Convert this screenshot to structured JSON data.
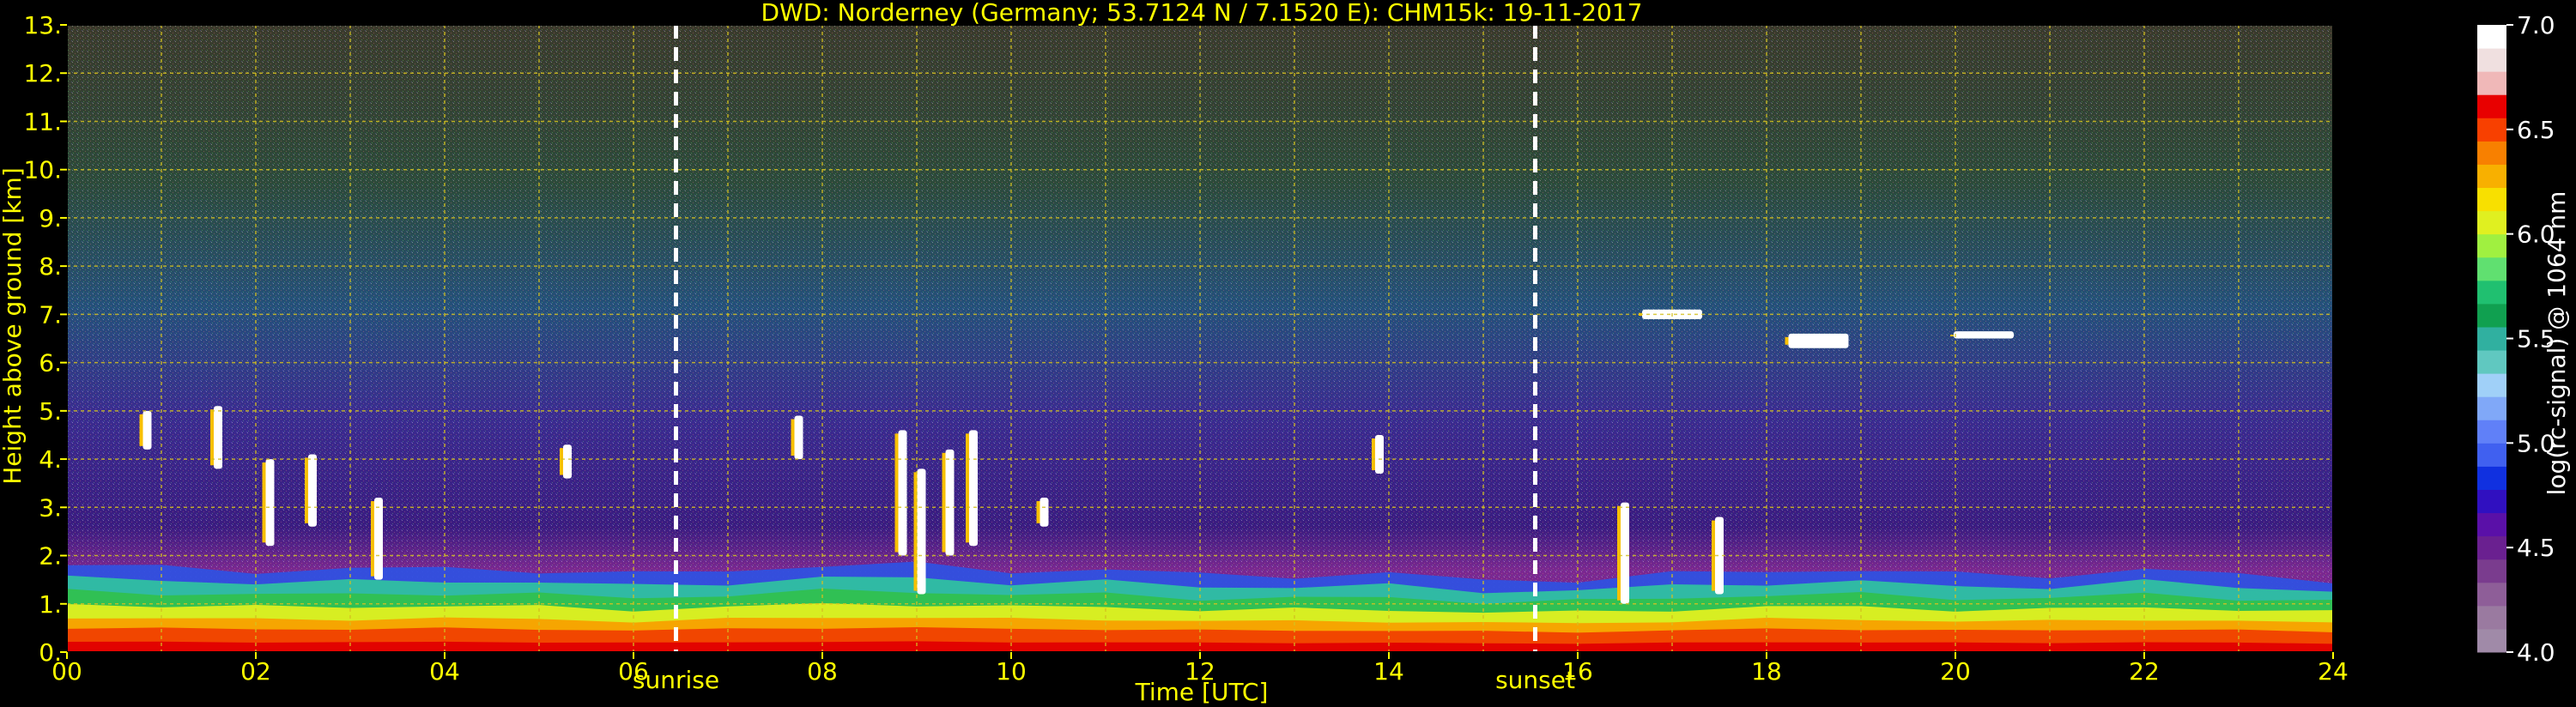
{
  "chart_data": {
    "type": "heatmap",
    "title": "DWD: Norderney (Germany; 53.7124 N / 7.1520 E):    CHM15k: 19-11-2017",
    "xlabel": "Time [UTC]",
    "ylabel": "Height above ground [km]",
    "xlim": [
      0,
      24
    ],
    "ylim": [
      0,
      13
    ],
    "x_ticks": [
      "00",
      "02",
      "04",
      "06",
      "08",
      "10",
      "12",
      "14",
      "16",
      "18",
      "20",
      "22",
      "24"
    ],
    "y_ticks": [
      "0.",
      "1.",
      "2.",
      "3.",
      "4.",
      "5.",
      "6.",
      "7.",
      "8.",
      "9.",
      "10.",
      "11.",
      "12.",
      "13."
    ],
    "grid": true,
    "sunrise": {
      "label": "sunrise",
      "time": 6.45
    },
    "sunset": {
      "label": "sunset",
      "time": 15.55
    },
    "colorbar": {
      "label": "log(rc-signal) @ 1064 nm",
      "min": 4.0,
      "max": 7.0,
      "ticks": [
        "4.0",
        "4.5",
        "5.0",
        "5.5",
        "6.0",
        "6.5",
        "7.0"
      ],
      "colors": [
        "#a08aa8",
        "#9a7aa0",
        "#8e5e98",
        "#7a3c8e",
        "#6a2090",
        "#5a10a8",
        "#3010c0",
        "#1030e0",
        "#4060f0",
        "#6080f8",
        "#80a8f8",
        "#a0d0f8",
        "#60c8c0",
        "#30b0a0",
        "#10a050",
        "#20c070",
        "#60e070",
        "#a0f040",
        "#e0f020",
        "#f8e000",
        "#f8b000",
        "#f88000",
        "#f84000",
        "#e80000",
        "#f0b8b8",
        "#f0e0e0",
        "#ffffff"
      ]
    },
    "colors": {
      "text": "#ffff00",
      "grid": "#d4c020",
      "background": "#000000"
    },
    "boundary_layer_top_km": [
      [
        0,
        1.8
      ],
      [
        1,
        1.75
      ],
      [
        2,
        1.7
      ],
      [
        3,
        1.7
      ],
      [
        4,
        1.75
      ],
      [
        5,
        1.7
      ],
      [
        6,
        1.6
      ],
      [
        7,
        1.7
      ],
      [
        8,
        1.8
      ],
      [
        9,
        1.8
      ],
      [
        10,
        1.7
      ],
      [
        11,
        1.7
      ],
      [
        12,
        1.6
      ],
      [
        13,
        1.6
      ],
      [
        14,
        1.6
      ],
      [
        15,
        1.5
      ],
      [
        16,
        1.5
      ],
      [
        17,
        1.6
      ],
      [
        18,
        1.7
      ],
      [
        19,
        1.7
      ],
      [
        20,
        1.6
      ],
      [
        21,
        1.6
      ],
      [
        22,
        1.7
      ],
      [
        23,
        1.6
      ],
      [
        24,
        1.5
      ]
    ],
    "cloud_features": [
      {
        "t": 0.85,
        "h0": 4.2,
        "h1": 5.0
      },
      {
        "t": 1.6,
        "h0": 3.8,
        "h1": 5.1
      },
      {
        "t": 2.15,
        "h0": 2.2,
        "h1": 4.0
      },
      {
        "t": 2.6,
        "h0": 2.6,
        "h1": 4.1
      },
      {
        "t": 3.3,
        "h0": 1.5,
        "h1": 3.2
      },
      {
        "t": 5.3,
        "h0": 3.6,
        "h1": 4.3
      },
      {
        "t": 7.75,
        "h0": 4.0,
        "h1": 4.9
      },
      {
        "t": 8.85,
        "h0": 2.0,
        "h1": 4.6
      },
      {
        "t": 9.05,
        "h0": 1.2,
        "h1": 3.8
      },
      {
        "t": 9.35,
        "h0": 2.0,
        "h1": 4.2
      },
      {
        "t": 9.6,
        "h0": 2.2,
        "h1": 4.6
      },
      {
        "t": 10.35,
        "h0": 2.6,
        "h1": 3.2
      },
      {
        "t": 13.9,
        "h0": 3.7,
        "h1": 4.5
      },
      {
        "t": 17.0,
        "h0": 6.9,
        "h1": 7.1
      },
      {
        "t": 18.55,
        "h0": 6.3,
        "h1": 6.6
      },
      {
        "t": 20.3,
        "h0": 6.5,
        "h1": 6.65
      },
      {
        "t": 16.5,
        "h0": 1.0,
        "h1": 3.1
      },
      {
        "t": 17.5,
        "h0": 1.2,
        "h1": 2.8
      }
    ]
  }
}
